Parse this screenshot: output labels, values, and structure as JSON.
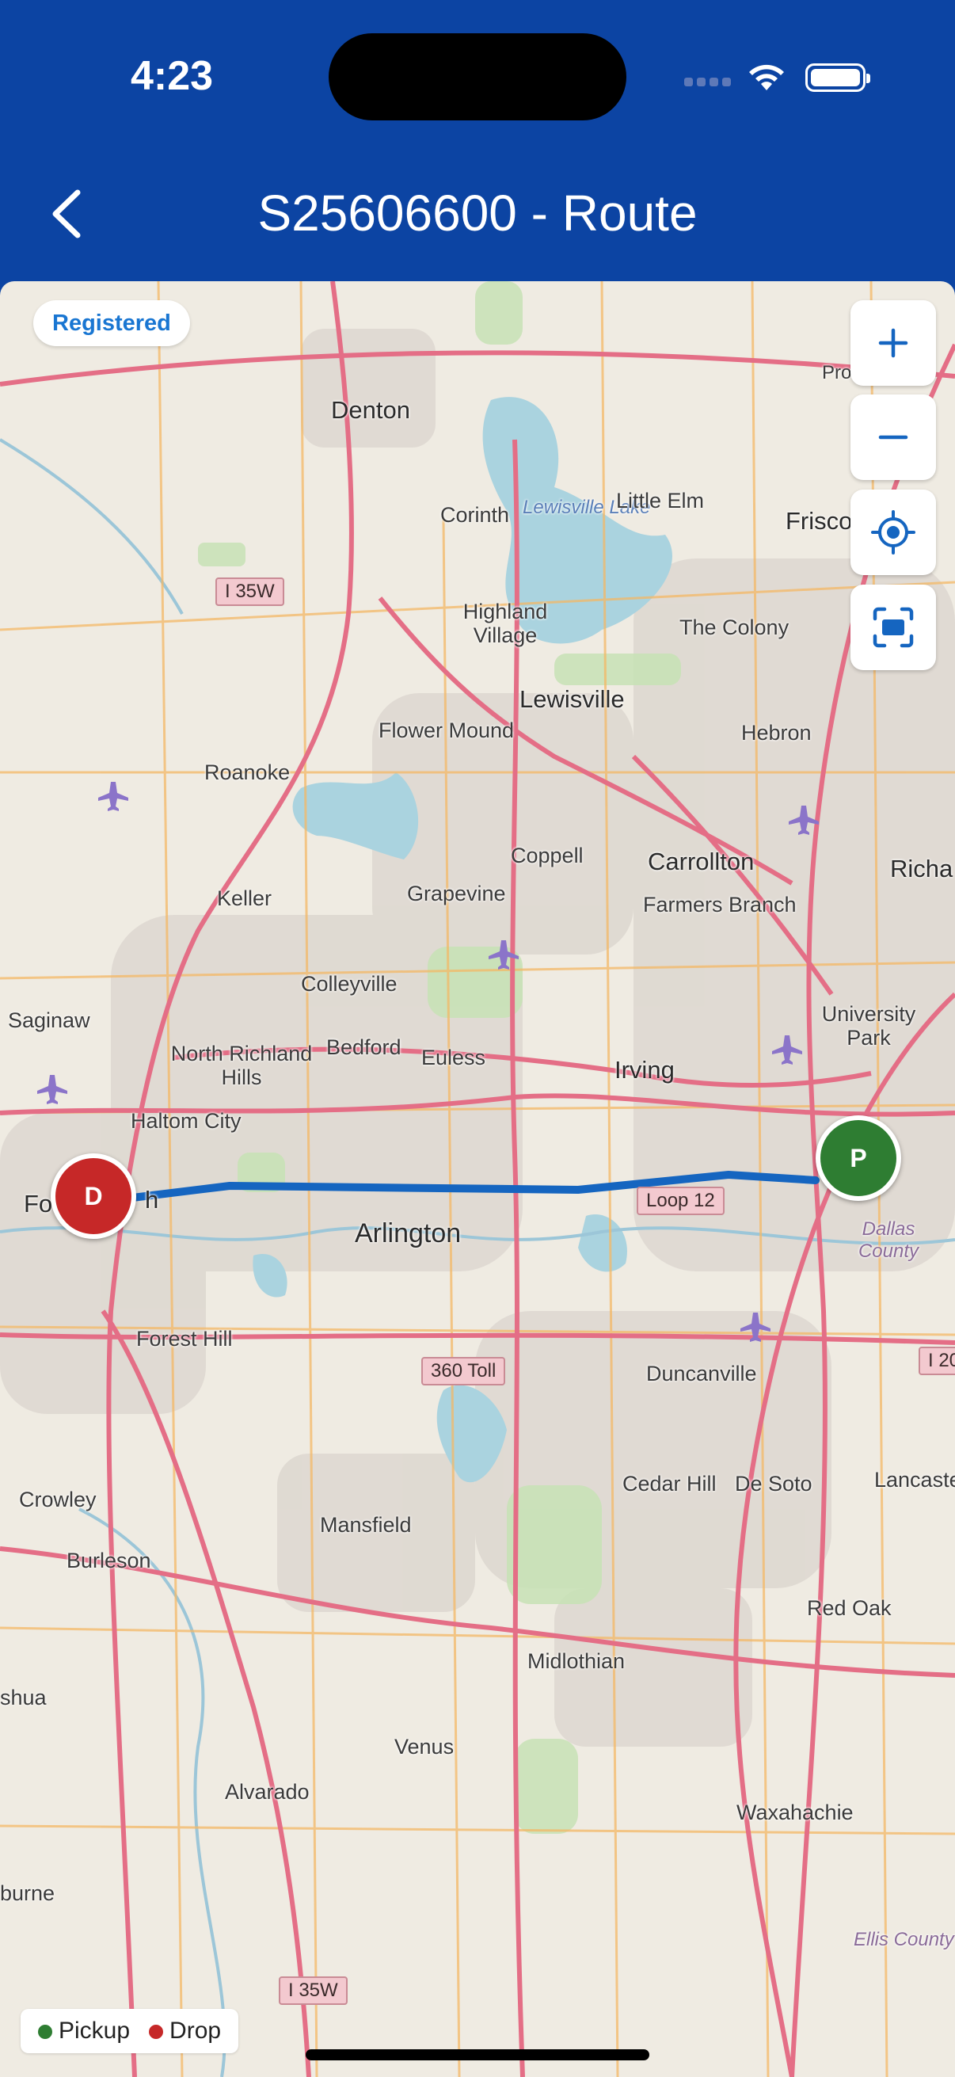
{
  "status_bar": {
    "time": "4:23"
  },
  "header": {
    "title": "S25606600 - Route",
    "back_icon": "chevron-left-icon"
  },
  "map": {
    "status_chip": "Registered",
    "controls": [
      {
        "name": "zoom-in-button",
        "icon": "plus-icon"
      },
      {
        "name": "zoom-out-button",
        "icon": "minus-icon"
      },
      {
        "name": "my-location-button",
        "icon": "crosshair-icon"
      },
      {
        "name": "fit-bounds-button",
        "icon": "fit-screen-icon"
      }
    ],
    "markers": {
      "pickup": {
        "letter": "P",
        "color": "#2e7d32"
      },
      "drop": {
        "letter": "D",
        "color": "#c62828"
      }
    },
    "route_color": "#1565c0",
    "place_labels": {
      "denton": "Denton",
      "corinth": "Corinth",
      "lewisville_lake": "Lewisville Lake",
      "little_elm": "Little Elm",
      "frisco": "Frisco",
      "prosper": "Prosper",
      "highland_village": "Highland Village",
      "the_colony": "The Colony",
      "lewisville": "Lewisville",
      "flower_mound": "Flower Mound",
      "hebron": "Hebron",
      "roanoke": "Roanoke",
      "coppell": "Coppell",
      "carrollton": "Carrollton",
      "richardson": "Richa",
      "keller": "Keller",
      "grapevine": "Grapevine",
      "farmers_branch": "Farmers Branch",
      "colleyville": "Colleyville",
      "saginaw": "Saginaw",
      "university_park": "University Park",
      "north_richland_hills": "North Richland Hills",
      "bedford": "Bedford",
      "euless": "Euless",
      "irving": "Irving",
      "haltom_city": "Haltom City",
      "fort_worth": "Fo",
      "fort_worth_tail": "h",
      "arlington": "Arlington",
      "dallas_county": "Dallas County",
      "forest_hill": "Forest Hill",
      "duncanville": "Duncanville",
      "crowley": "Crowley",
      "cedar_hill": "Cedar Hill",
      "de_soto": "De Soto",
      "lancaster": "Lancaste",
      "mansfield": "Mansfield",
      "burleson": "Burleson",
      "red_oak": "Red Oak",
      "midlothian": "Midlothian",
      "joshua": "shua",
      "venus": "Venus",
      "alvarado": "Alvarado",
      "waxahachie": "Waxahachie",
      "cleburne": "burne",
      "ellis_county": "Ellis County"
    },
    "road_shields": {
      "i35w_north": "I 35W",
      "loop12": "Loop 12",
      "toll360": "360 Toll",
      "i35w_south": "I 35W",
      "i20": "I 20"
    },
    "legend": {
      "pickup": "Pickup",
      "drop": "Drop"
    }
  }
}
